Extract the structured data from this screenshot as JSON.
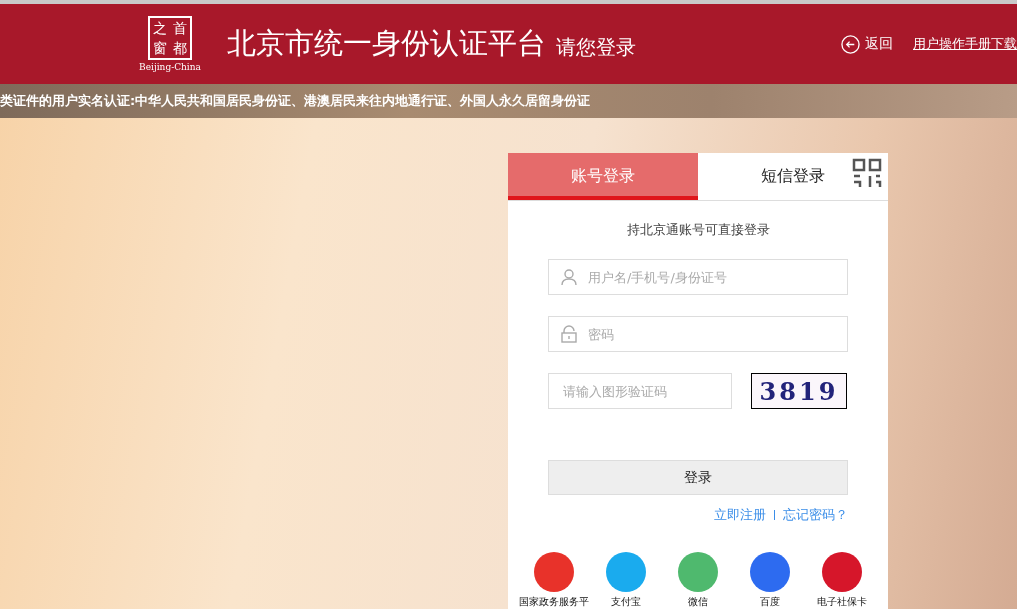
{
  "header": {
    "logo": {
      "chars": [
        "之",
        "首",
        "窗",
        "都"
      ],
      "caption": "Beijing-China"
    },
    "title": "北京市统一身份认证平台",
    "subtitle": "请您登录",
    "back": "返回",
    "manual_link": "用户操作手册下载"
  },
  "banner": "类证件的用户实名认证:中华人民共和国居民身份证、港澳居民来往内地通行证、外国人永久居留身份证",
  "login": {
    "tabs": [
      {
        "label": "账号登录",
        "selected": true
      },
      {
        "label": "短信登录",
        "selected": false
      }
    ],
    "hint": "持北京通账号可直接登录",
    "fields": [
      {
        "kind": "user",
        "placeholder": "用户名/手机号/身份证号"
      },
      {
        "kind": "password",
        "placeholder": "密码"
      },
      {
        "kind": "captcha",
        "placeholder": "请输入图形验证码",
        "captcha": "3819"
      }
    ],
    "submit": "登录",
    "links": [
      "立即注册",
      "忘记密码？"
    ],
    "providers": [
      {
        "label": "国家政务服务平",
        "color": "#e8322a"
      },
      {
        "label": "支付宝",
        "color": "#1aabee"
      },
      {
        "label": "微信",
        "color": "#4fb96e"
      },
      {
        "label": "百度",
        "color": "#2d6bf0"
      },
      {
        "label": "电子社保卡",
        "color": "#d6162a"
      }
    ]
  }
}
